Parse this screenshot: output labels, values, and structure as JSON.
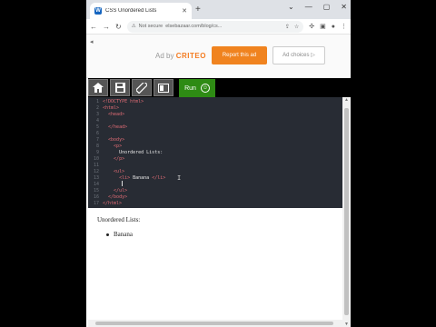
{
  "browser": {
    "tab_title": "CSS Unordered Lists",
    "tab_favicon": "W",
    "new_tab": "+",
    "window_controls": [
      "⌄",
      "—",
      "▢",
      "✕"
    ],
    "security": "Not secure",
    "url": "elsebazaar.com/blog/cs..."
  },
  "ad": {
    "ad_by": "Ad by",
    "brand": "CRITEO",
    "report_label": "Report this ad",
    "choices_label": "Ad choices"
  },
  "editor_toolbar": {
    "run_label": "Run",
    "icons": [
      "home-icon",
      "save-icon",
      "theme-icon",
      "layout-icon"
    ]
  },
  "code": {
    "line_numbers": [
      "1",
      "2",
      "3",
      "4",
      "5",
      "6",
      "7",
      "8",
      "9",
      "10",
      "11",
      "12",
      "13",
      "14",
      "15",
      "16",
      "17"
    ],
    "lines": [
      "<!DOCTYPE html>",
      "<html>",
      "  <head>",
      "",
      "  </head>",
      "",
      "  <body>",
      "    <p>",
      "      Unordered Lists:",
      "    </p>",
      "",
      "    <ul>",
      "      <li> Banana </li>",
      "",
      "    </ul>",
      "  </body>",
      "</html>"
    ]
  },
  "output": {
    "paragraph": "Unordered Lists:",
    "list_items": [
      "Banana"
    ]
  }
}
